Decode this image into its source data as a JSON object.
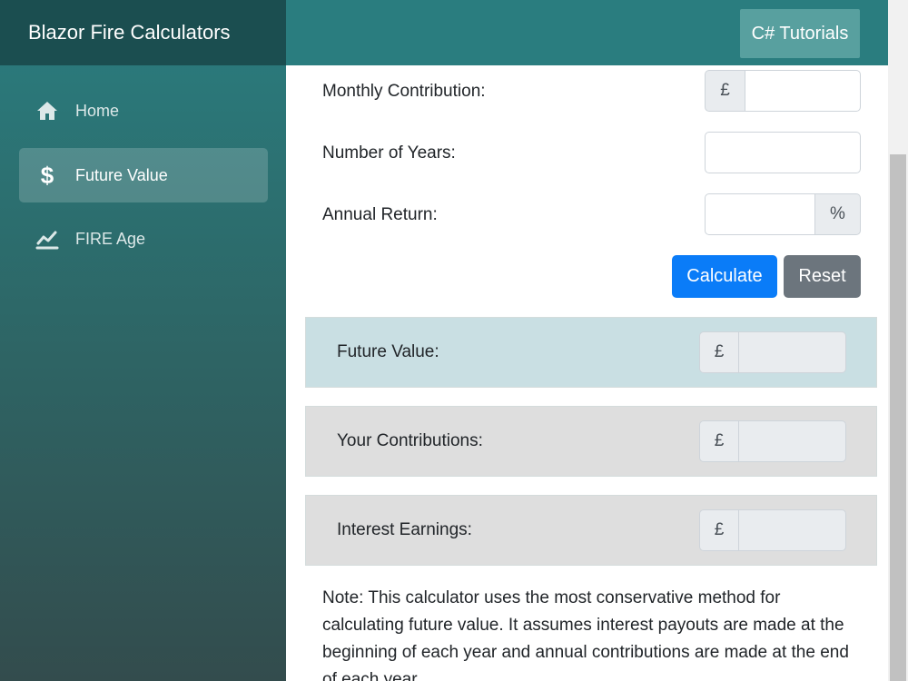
{
  "sidebar": {
    "brand": "Blazor Fire Calculators",
    "items": [
      {
        "label": "Home",
        "icon": "home-icon"
      },
      {
        "label": "Future Value",
        "icon": "dollar-icon",
        "active": true
      },
      {
        "label": "FIRE Age",
        "icon": "chart-line-icon"
      }
    ]
  },
  "topbar": {
    "link_label": "C# Tutorials"
  },
  "form": {
    "monthly_contribution": {
      "label": "Monthly Contribution:",
      "prefix": "£",
      "value": ""
    },
    "number_of_years": {
      "label": "Number of Years:",
      "value": ""
    },
    "annual_return": {
      "label": "Annual Return:",
      "suffix": "%",
      "value": ""
    },
    "calculate_label": "Calculate",
    "reset_label": "Reset"
  },
  "results": {
    "future_value": {
      "label": "Future Value:",
      "prefix": "£",
      "value": ""
    },
    "your_contributions": {
      "label": "Your Contributions:",
      "prefix": "£",
      "value": ""
    },
    "interest_earnings": {
      "label": "Interest Earnings:",
      "prefix": "£",
      "value": ""
    }
  },
  "note": "Note: This calculator uses the most conservative method for calculating future value. It assumes interest payouts are made at the beginning of each year and annual contributions are made at the end of each year.",
  "colors": {
    "primary": "#0a7cf8",
    "secondary": "#6c757d",
    "sidebar_top": "#2a7d7f",
    "sidebar_bottom": "#334c4d",
    "highlight_card": "#c9dfe3"
  }
}
